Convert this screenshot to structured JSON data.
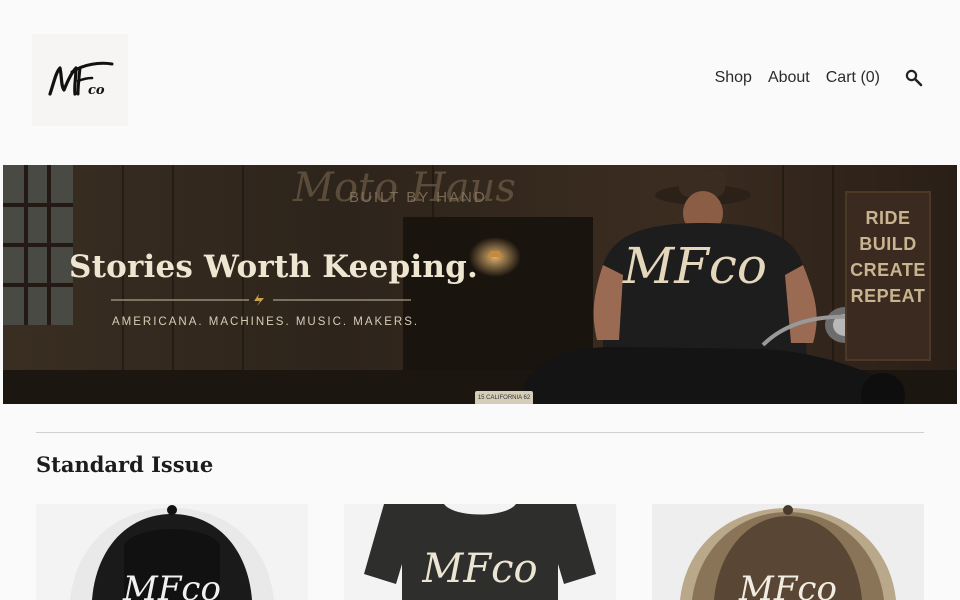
{
  "header": {
    "logo_alt": "MFco",
    "nav": {
      "shop_label": "Shop",
      "about_label": "About",
      "cart_label": "Cart",
      "cart_count": "0"
    },
    "search_icon": "search-icon"
  },
  "banner": {
    "headline": "Stories Worth Keeping.",
    "tagline": "AMERICANA. MACHINES. MUSIC. MAKERS.",
    "wall_text": "Moto Haus",
    "wall_subtext": "BUILT BY HAND",
    "sign_lines": [
      "RIDE",
      "BUILD",
      "CREATE",
      "REPEAT"
    ],
    "plate_text": "15 CALIFORNIA 62",
    "shirt_logo": "MFco"
  },
  "section": {
    "title": "Standard Issue"
  },
  "products": [
    {
      "image": "black-trucker-hat",
      "logo": "MFco"
    },
    {
      "image": "charcoal-tshirt",
      "logo": "MFco"
    },
    {
      "image": "brown-trucker-hat",
      "logo": "MFco"
    }
  ],
  "colors": {
    "background": "#fafafa",
    "text": "#2b2b2b",
    "banner_text": "#efe6d2",
    "accent_gold": "#c9a24a"
  }
}
